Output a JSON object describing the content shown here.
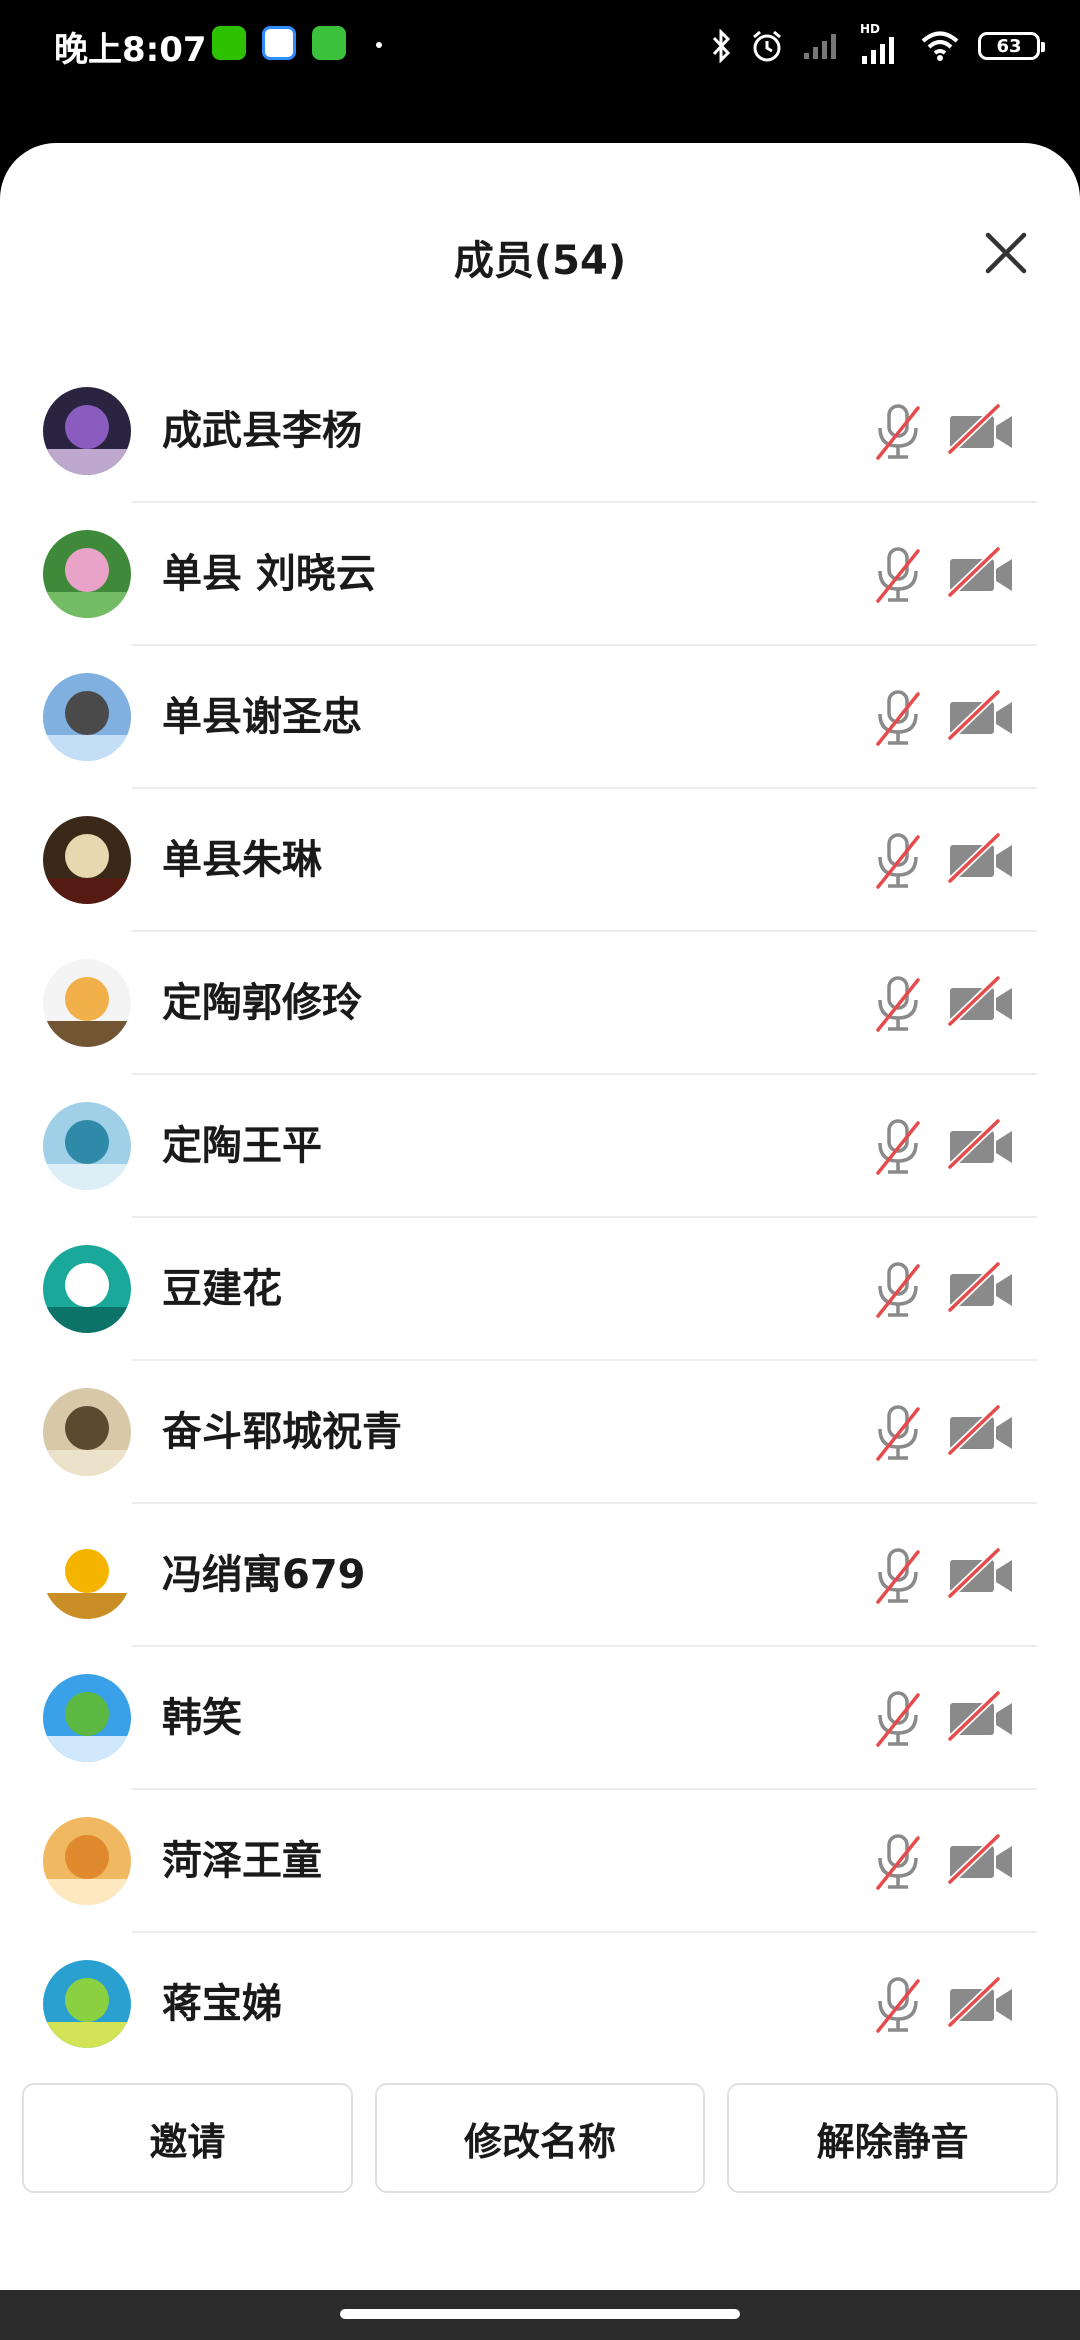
{
  "status_bar": {
    "time": "晚上8:07",
    "battery_level": "63",
    "network_label": "HD"
  },
  "dialog": {
    "title": "成员(54)"
  },
  "members": [
    {
      "name": "成武县李杨",
      "mic_muted": true,
      "camera_off": true
    },
    {
      "name": "单县 刘晓云",
      "mic_muted": true,
      "camera_off": true
    },
    {
      "name": "单县谢圣忠",
      "mic_muted": true,
      "camera_off": true
    },
    {
      "name": "单县朱琳",
      "mic_muted": true,
      "camera_off": true
    },
    {
      "name": "定陶郭修玲",
      "mic_muted": true,
      "camera_off": true
    },
    {
      "name": "定陶王平",
      "mic_muted": true,
      "camera_off": true
    },
    {
      "name": "豆建花",
      "mic_muted": true,
      "camera_off": true
    },
    {
      "name": "奋斗郓城祝青",
      "mic_muted": true,
      "camera_off": true
    },
    {
      "name": "冯绡寓679",
      "mic_muted": true,
      "camera_off": true
    },
    {
      "name": "韩笑",
      "mic_muted": true,
      "camera_off": true
    },
    {
      "name": "菏泽王童",
      "mic_muted": true,
      "camera_off": true
    },
    {
      "name": "蒋宝娣",
      "mic_muted": true,
      "camera_off": true
    }
  ],
  "actions": {
    "invite": "邀请",
    "rename": "修改名称",
    "unmute": "解除静音"
  },
  "colors": {
    "muted_red": "#e64b4b",
    "icon_gray": "#8a8a8a"
  }
}
